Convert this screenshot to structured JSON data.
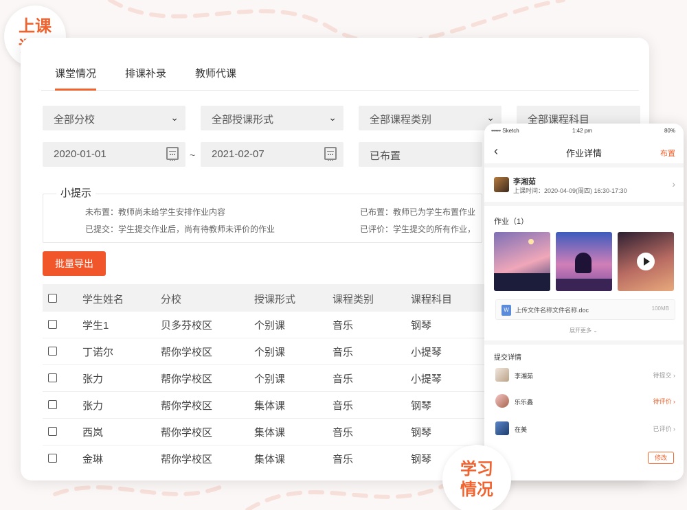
{
  "badges": {
    "lesson_line1": "上课",
    "lesson_line2": "评价",
    "study_line1": "学习",
    "study_line2": "情况"
  },
  "tabs": [
    {
      "label": "课堂情况",
      "active": true
    },
    {
      "label": "排课补录",
      "active": false
    },
    {
      "label": "教师代课",
      "active": false
    }
  ],
  "filters": {
    "branch": "全部分校",
    "teach_mode": "全部授课形式",
    "course_type": "全部课程类别",
    "subject": "全部课程科目",
    "date_from": "2020-01-01",
    "date_sep": "~",
    "date_to": "2021-02-07",
    "status": "已布置"
  },
  "tips": {
    "title": "小提示",
    "line1": "未布置：教师尚未给学生安排作业内容",
    "line2": "已提交：学生提交作业后，尚有待教师未评价的作业",
    "line3": "已布置：教师已为学生布置作业",
    "line4": "已评价：学生提交的所有作业，"
  },
  "actions": {
    "export": "批量导出"
  },
  "table": {
    "headers": [
      "学生姓名",
      "分校",
      "授课形式",
      "课程类别",
      "课程科目"
    ],
    "rows": [
      [
        "学生1",
        "贝多芬校区",
        "个别课",
        "音乐",
        "钢琴"
      ],
      [
        "丁诺尔",
        "帮你学校区",
        "个别课",
        "音乐",
        "小提琴"
      ],
      [
        "张力",
        "帮你学校区",
        "个别课",
        "音乐",
        "小提琴"
      ],
      [
        "张力",
        "帮你学校区",
        "集体课",
        "音乐",
        "钢琴"
      ],
      [
        "西岚",
        "帮你学校区",
        "集体课",
        "音乐",
        "钢琴"
      ],
      [
        "金琳",
        "帮你学校区",
        "集体课",
        "音乐",
        "钢琴"
      ]
    ]
  },
  "phone": {
    "status_carrier": "••••• Sketch",
    "status_time": "1:42 pm",
    "status_battery": "80%",
    "title": "作业详情",
    "publish": "布置",
    "teacher_name": "李湘茹",
    "class_time": "上课时间：2020-04-09(周四) 16:30-17:30",
    "homework_label": "作业（1）",
    "file_name": "上传文件名称文件名称.doc",
    "file_size": "100MB",
    "expand": "展开更多",
    "submit_label": "提交详情",
    "submissions": [
      {
        "name": "李湘茹",
        "status": "待提交"
      },
      {
        "name": "乐乐鑫",
        "status": "待评价"
      },
      {
        "name": "在美",
        "status": "已评价"
      }
    ],
    "edit_button": "修改"
  }
}
